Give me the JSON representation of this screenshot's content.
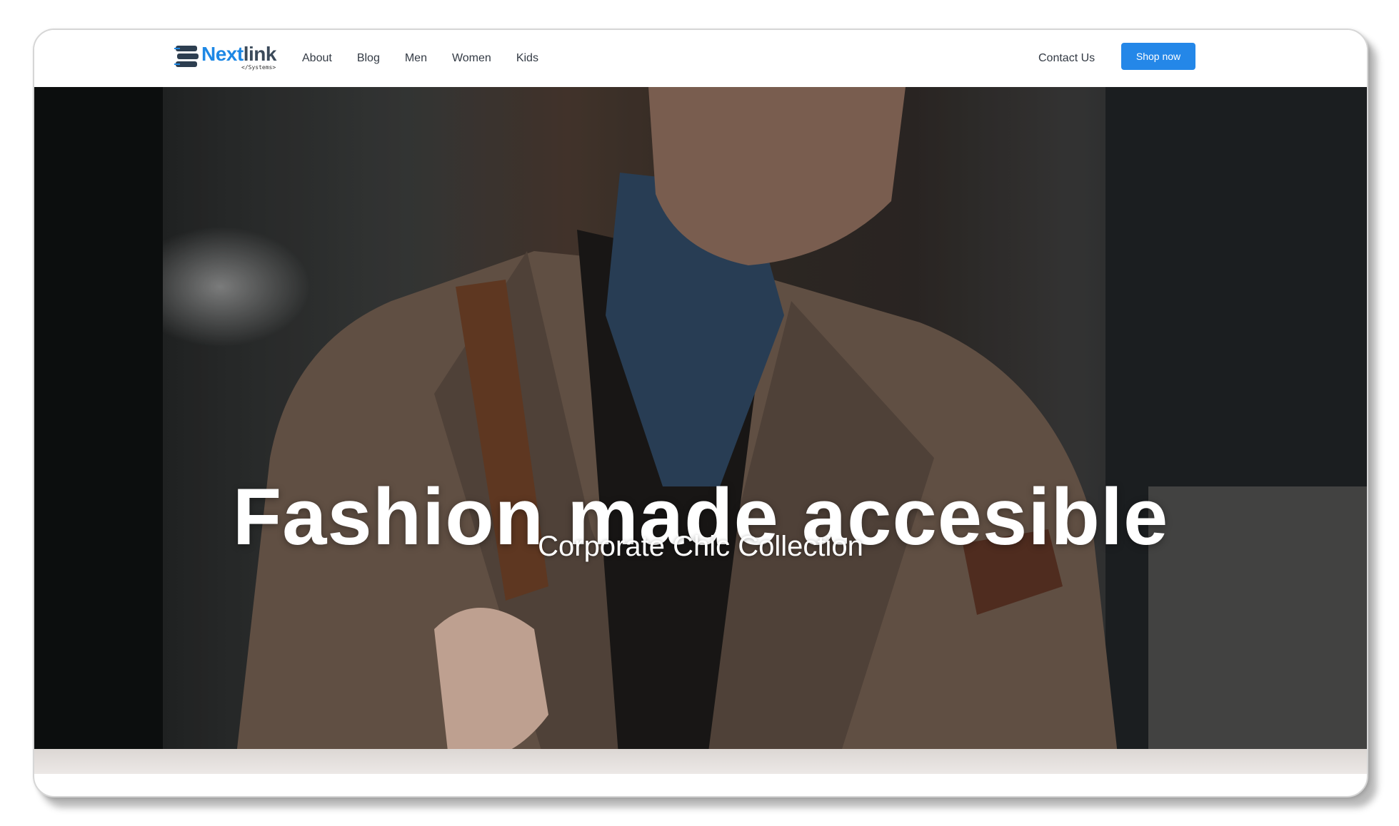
{
  "brand": {
    "name_part1": "Next",
    "name_part2": "link",
    "tagline": "</Systems>",
    "colors": {
      "accent": "#1e88e5",
      "dark": "#3b4a5a"
    }
  },
  "nav": {
    "items": [
      {
        "label": "About"
      },
      {
        "label": "Blog"
      },
      {
        "label": "Men"
      },
      {
        "label": "Women"
      },
      {
        "label": "Kids"
      }
    ],
    "contact_label": "Contact Us",
    "cta_label": "Shop now",
    "cta_color": "#2487e8"
  },
  "hero": {
    "title": "Fashion made accesible",
    "subtitle": "Corporate Chic Collection"
  }
}
